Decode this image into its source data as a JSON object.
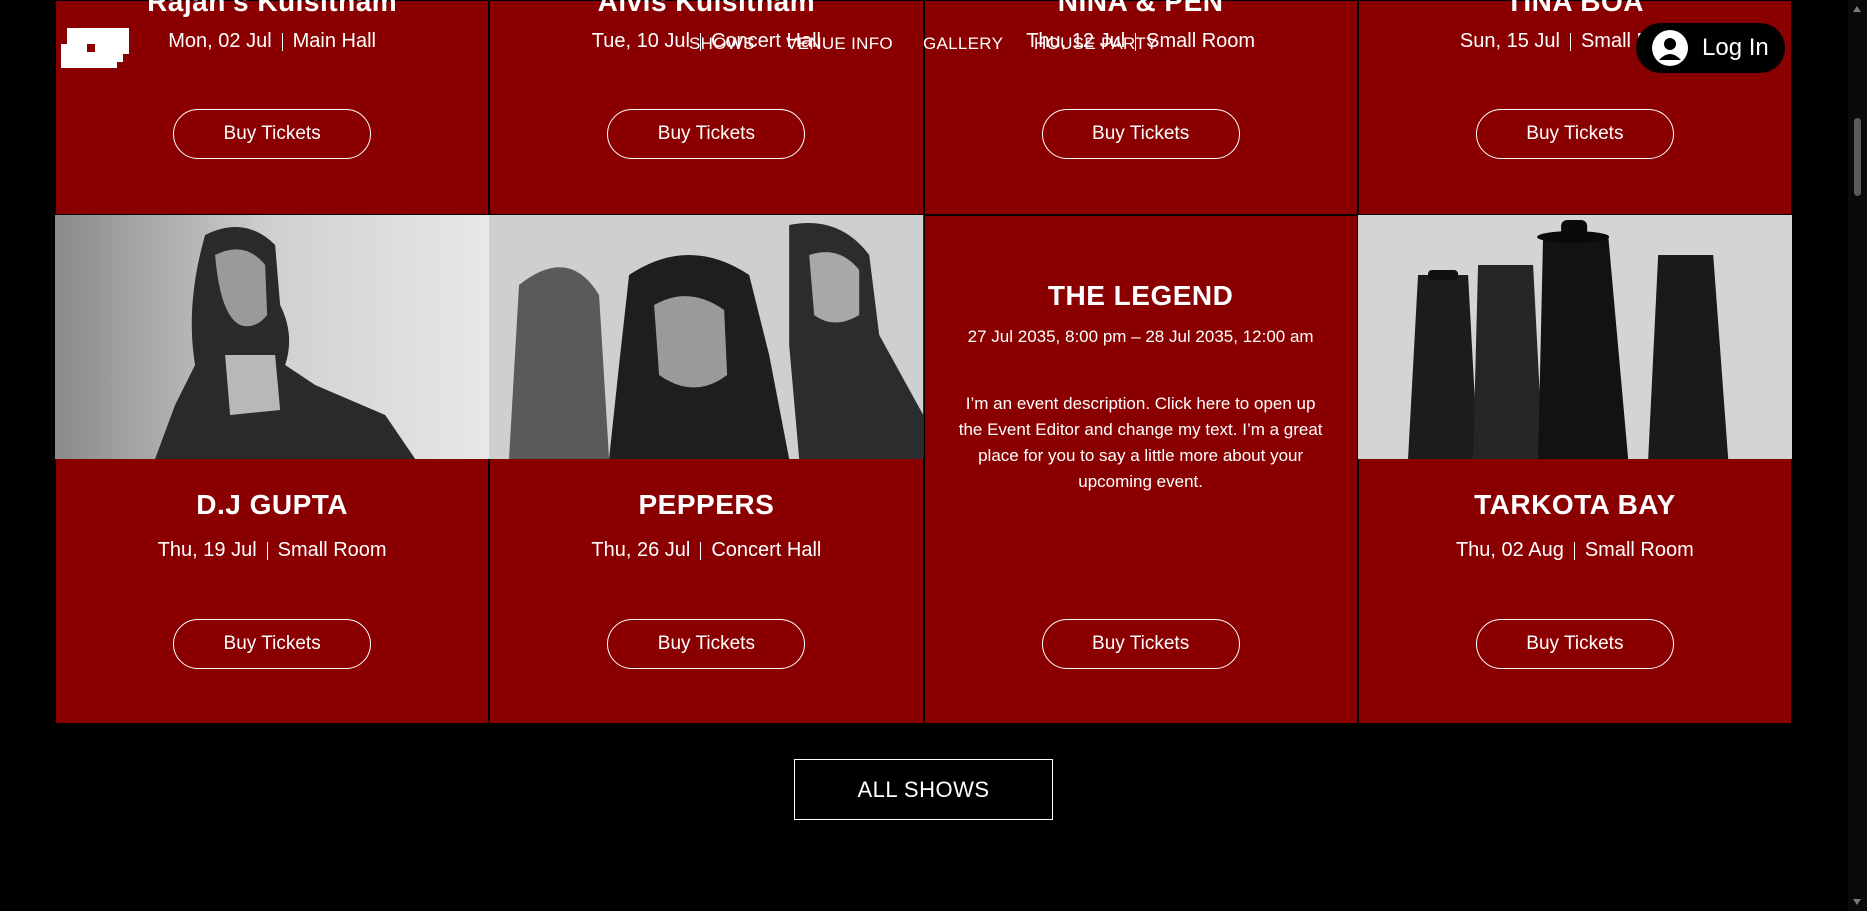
{
  "nav": {
    "items": [
      "SHOWS",
      "VENUE INFO",
      "GALLERY",
      "HOUSE PARTY"
    ],
    "login_label": "Log In"
  },
  "events_row1": [
    {
      "title": "Rajan's Kulsitham",
      "date": "Mon, 02 Jul",
      "venue": "Main Hall",
      "button": "Buy Tickets"
    },
    {
      "title": "Alvis Kulsitham",
      "date": "Tue, 10 Jul",
      "venue": "Concert Hall",
      "button": "Buy Tickets"
    },
    {
      "title": "NINA & PEN",
      "date": "Thu, 12 Jul",
      "venue": "Small Room",
      "button": "Buy Tickets"
    },
    {
      "title": "TINA BOA",
      "date": "Sun, 15 Jul",
      "venue": "Small Room",
      "button": "Buy Tickets"
    }
  ],
  "events_row2": [
    {
      "title": "D.J GUPTA",
      "date": "Thu, 19 Jul",
      "venue": "Small Room",
      "button": "Buy Tickets"
    },
    {
      "title": "PEPPERS",
      "date": "Thu, 26 Jul",
      "venue": "Concert Hall",
      "button": "Buy Tickets"
    },
    {
      "title": "THE LEGEND",
      "datetime": "27 Jul 2035, 8:00 pm – 28 Jul 2035, 12:00 am",
      "description": "I’m an event description. Click here to open up the Event Editor and change my text. I’m a great place for you to say a little more about your upcoming event.",
      "button": "Buy Tickets"
    },
    {
      "title": "TARKOTA BAY",
      "date": "Thu, 02 Aug",
      "venue": "Small Room",
      "button": "Buy Tickets"
    }
  ],
  "all_shows_label": "ALL SHOWS",
  "colors": {
    "card_bg": "#8a0000",
    "page_bg": "#000000",
    "text": "#ffffff"
  }
}
